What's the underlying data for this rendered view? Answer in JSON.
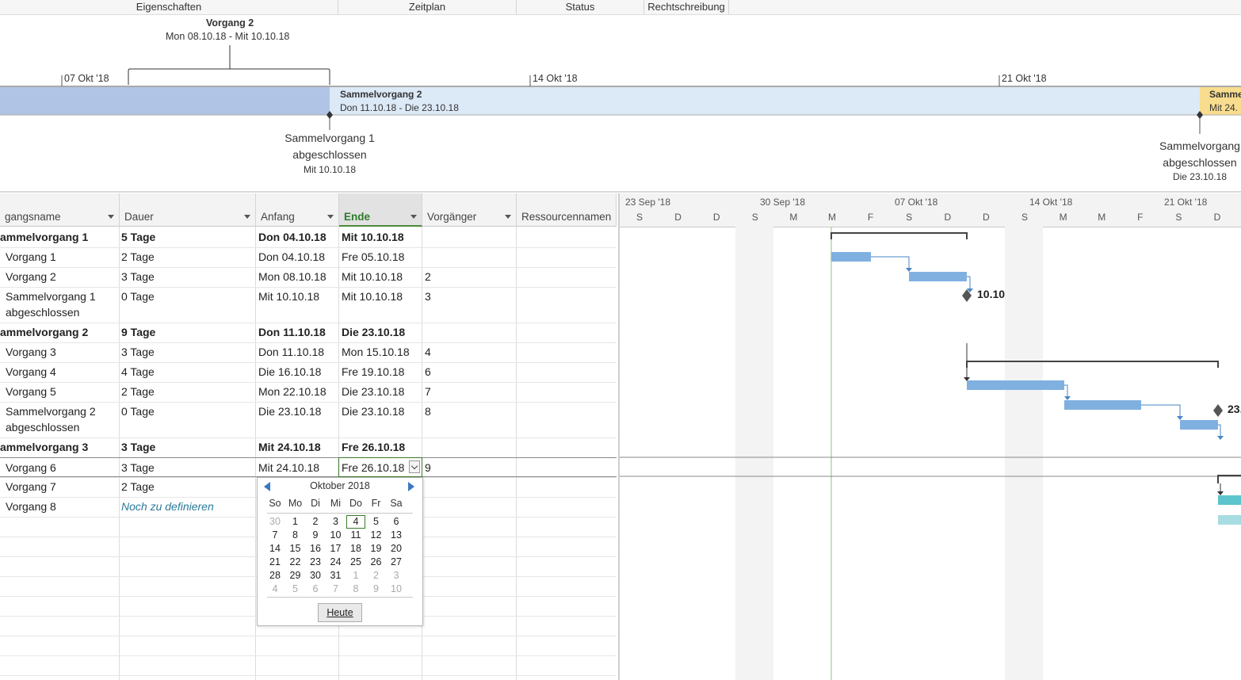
{
  "ribbon": {
    "groups": [
      "Eigenschaften",
      "Zeitplan",
      "Status",
      "Rechtschreibung"
    ]
  },
  "timeline": {
    "callout_title": "Vorgang 2",
    "callout_dates": "Mon 08.10.18 - Mit 10.10.18",
    "ticks": [
      "07 Okt '18",
      "14 Okt '18",
      "21 Okt '18"
    ],
    "summary2_title": "Sammelvorgang 2",
    "summary2_dates": "Don 11.10.18 - Die 23.10.18",
    "summary3_title": "Samme",
    "summary3_dates": "Mit 24.",
    "milestone1_line1": "Sammelvorgang 1",
    "milestone1_line2": "abgeschlossen",
    "milestone1_date": "Mit 10.10.18",
    "milestone2_line1": "Sammelvorgang",
    "milestone2_line2": "abgeschlossen",
    "milestone2_date": "Die 23.10.18"
  },
  "table": {
    "headers": [
      "gangsname",
      "Dauer",
      "Anfang",
      "Ende",
      "Vorgänger",
      "Ressourcennamen"
    ],
    "rows": [
      {
        "name": "ammelvorgang 1",
        "dur": "5 Tage",
        "start": "Don 04.10.18",
        "end": "Mit 10.10.18",
        "pred": "",
        "bold": true
      },
      {
        "name": "Vorgang 1",
        "dur": "2 Tage",
        "start": "Don 04.10.18",
        "end": "Fre 05.10.18",
        "pred": ""
      },
      {
        "name": "Vorgang 2",
        "dur": "3 Tage",
        "start": "Mon 08.10.18",
        "end": "Mit 10.10.18",
        "pred": "2"
      },
      {
        "name": "Sammelvorgang 1",
        "name2": "abgeschlossen",
        "dur": "0 Tage",
        "start": "Mit 10.10.18",
        "end": "Mit 10.10.18",
        "pred": "3"
      },
      {
        "name": "ammelvorgang 2",
        "dur": "9 Tage",
        "start": "Don 11.10.18",
        "end": "Die 23.10.18",
        "pred": "",
        "bold": true
      },
      {
        "name": "Vorgang 3",
        "dur": "3 Tage",
        "start": "Don 11.10.18",
        "end": "Mon 15.10.18",
        "pred": "4"
      },
      {
        "name": "Vorgang 4",
        "dur": "4 Tage",
        "start": "Die 16.10.18",
        "end": "Fre 19.10.18",
        "pred": "6"
      },
      {
        "name": "Vorgang 5",
        "dur": "2 Tage",
        "start": "Mon 22.10.18",
        "end": "Die 23.10.18",
        "pred": "7"
      },
      {
        "name": "Sammelvorgang 2",
        "name2": "abgeschlossen",
        "dur": "0 Tage",
        "start": "Die 23.10.18",
        "end": "Die 23.10.18",
        "pred": "8"
      },
      {
        "name": "ammelvorgang 3",
        "dur": "3 Tage",
        "start": "Mit 24.10.18",
        "end": "Fre 26.10.18",
        "pred": "",
        "bold": true
      },
      {
        "name": "Vorgang 6",
        "dur": "3 Tage",
        "start": "Mit 24.10.18",
        "end": "Fre 26.10.18",
        "pred": "9"
      },
      {
        "name": "Vorgang 7",
        "dur": "2 Tage",
        "start": "",
        "end": "",
        "pred": ""
      },
      {
        "name": "Vorgang 8",
        "dur": "Noch zu definieren",
        "start": "",
        "end": "",
        "pred": ""
      }
    ]
  },
  "gantt": {
    "weeks": [
      "23 Sep '18",
      "30 Sep '18",
      "07 Okt '18",
      "14 Okt '18",
      "21 Okt '18"
    ],
    "days": [
      "S",
      "D",
      "D",
      "S",
      "M",
      "M",
      "F",
      "S",
      "D",
      "D",
      "S",
      "M",
      "M",
      "F",
      "S",
      "D"
    ],
    "milestone1_label": "10.10",
    "milestone2_label": "23."
  },
  "calendar": {
    "month": "Oktober 2018",
    "weekdays": [
      "So",
      "Mo",
      "Di",
      "Mi",
      "Do",
      "Fr",
      "Sa"
    ],
    "weeks": [
      [
        "30",
        "1",
        "2",
        "3",
        "4",
        "5",
        "6"
      ],
      [
        "7",
        "8",
        "9",
        "10",
        "11",
        "12",
        "13"
      ],
      [
        "14",
        "15",
        "16",
        "17",
        "18",
        "19",
        "20"
      ],
      [
        "21",
        "22",
        "23",
        "24",
        "25",
        "26",
        "27"
      ],
      [
        "28",
        "29",
        "30",
        "31",
        "1",
        "2",
        "3"
      ],
      [
        "4",
        "5",
        "6",
        "7",
        "8",
        "9",
        "10"
      ]
    ],
    "today_button": "Heute"
  },
  "colors": {
    "task_bar": "#7fb0e0",
    "summary2_band": "#dce9f7",
    "summary1_band": "#b0c4e6",
    "summary3_band": "#f9dd8e",
    "active_task_bar": "#5cc4cc",
    "green_line": "#6aa84f"
  }
}
